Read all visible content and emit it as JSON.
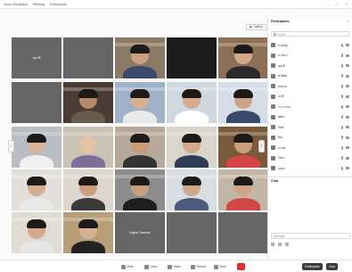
{
  "topbar": {
    "menu": [
      "Zoom Workplace",
      "Meeting",
      "Participants"
    ],
    "window_controls": [
      "–",
      "□",
      "×"
    ]
  },
  "view": {
    "gallery_label": "Gallery"
  },
  "tiles": [
    {
      "label": "",
      "center": "สุชาติ",
      "style": "name"
    },
    {
      "label": "",
      "center": "",
      "style": "name"
    },
    {
      "label": "",
      "center": "",
      "style": "room"
    },
    {
      "label": "",
      "center": "",
      "style": "dark"
    },
    {
      "label": "",
      "center": "",
      "style": "person-a"
    },
    {
      "label": "",
      "center": "",
      "style": "name"
    },
    {
      "label": "",
      "center": "",
      "style": "room2"
    },
    {
      "label": "",
      "center": "",
      "style": "person-b"
    },
    {
      "label": "",
      "center": "",
      "style": "person-c"
    },
    {
      "label": "",
      "center": "",
      "style": "person-d"
    },
    {
      "label": "",
      "center": "",
      "style": "person-e"
    },
    {
      "label": "",
      "center": "",
      "style": "person-f"
    },
    {
      "label": "",
      "center": "",
      "style": "person-g"
    },
    {
      "label": "",
      "center": "",
      "style": "person-h"
    },
    {
      "label": "",
      "center": "",
      "style": "person-i"
    },
    {
      "label": "",
      "center": "",
      "style": "person-j"
    },
    {
      "label": "",
      "center": "",
      "style": "person-k"
    },
    {
      "label": "",
      "center": "",
      "style": "person-l"
    },
    {
      "label": "",
      "center": "",
      "style": "person-m"
    },
    {
      "label": "",
      "center": "",
      "style": "person-n"
    },
    {
      "label": "",
      "center": "",
      "style": "person-o"
    },
    {
      "label": "",
      "center": "",
      "style": "person-p"
    },
    {
      "label": "",
      "center": "Digital Teacher",
      "style": "name"
    },
    {
      "label": "",
      "center": "",
      "style": "name"
    },
    {
      "label": "",
      "center": "",
      "style": "name"
    }
  ],
  "side": {
    "title": "Participants",
    "search_placeholder": "Search",
    "participants": [
      "นายณัฐ",
      "นางสาว",
      "สุชาติ",
      "พรทิพย์",
      "สมชาย",
      "อรุณี",
      "วิภาวรรณ",
      "ศศิธร",
      "กิตติ",
      "ปิยะ",
      "มานพ",
      "รัตนา",
      "อนุชา"
    ],
    "chat_title": "Chat",
    "chat_lines": [
      {
        "text": "",
        "color": "#333333"
      },
      {
        "text": "",
        "color": "#2a6fd6"
      },
      {
        "text": "",
        "color": "#333333"
      },
      {
        "text": "",
        "color": "#2a6fd6"
      },
      {
        "text": "",
        "color": "#2a6fd6"
      }
    ],
    "chat_placeholder": "Message"
  },
  "bottombar": {
    "buttons": [
      "Mute",
      "Video",
      "Share",
      "Record",
      "More"
    ],
    "participants_label": "Participants",
    "chat_label": "Chat"
  },
  "colors": {
    "end_button": "#e22b2b",
    "link": "#2a6fd6"
  }
}
